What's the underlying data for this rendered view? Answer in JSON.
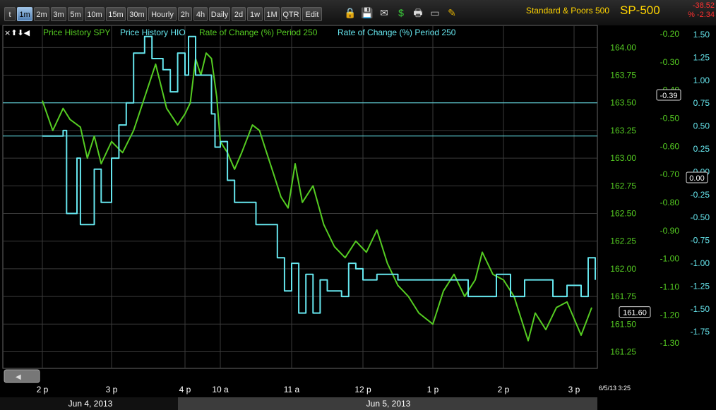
{
  "toolbar": {
    "buttons": [
      "t",
      "1m",
      "2m",
      "3m",
      "5m",
      "10m",
      "15m",
      "30m",
      "Hourly",
      "2h",
      "4h",
      "Daily",
      "2d",
      "1w",
      "1M",
      "QTR",
      "Edit"
    ],
    "active": "1m",
    "icons": [
      "lock-icon",
      "save-icon",
      "mail-icon",
      "dollar-icon",
      "print-icon",
      "window-icon",
      "pencil-icon"
    ]
  },
  "header": {
    "name": "Standard & Poors 500",
    "symbol": "SP-500",
    "change": "-38.52",
    "change_pct": "% -2.34",
    "change_color": "#ff3030",
    "symbol_color": "#ffd400"
  },
  "legend": {
    "controls": "×⬆⬇◀",
    "items": [
      {
        "label": "Price History SPY",
        "color": "#55cc22"
      },
      {
        "label": "Price History HIO",
        "color": "#66e6ee"
      },
      {
        "label": "Rate of Change (%) Period 250",
        "color": "#55cc22"
      },
      {
        "label": "Rate of Change (%) Period 250",
        "color": "#66e6ee"
      }
    ]
  },
  "chart_data": {
    "type": "line",
    "x_ticks": [
      "2 p",
      "3 p",
      "4 p",
      "10 a",
      "11 a",
      "12 p",
      "1 p",
      "2 p",
      "3 p"
    ],
    "date_bar": [
      "Jun 4, 2013",
      "Jun 5, 2013"
    ],
    "corner_label": "6/5/13 3:25",
    "ylim_price": [
      161.1,
      164.2
    ],
    "ylim_roc_spy": [
      -1.39,
      -0.17
    ],
    "ylim_roc_hio": [
      -2.15,
      1.6
    ],
    "y_price_ticks": [
      "164.00",
      "163.75",
      "163.50",
      "163.25",
      "163.00",
      "162.75",
      "162.50",
      "162.25",
      "162.00",
      "161.75",
      "161.50",
      "161.25"
    ],
    "y_roc_spy_ticks": [
      "-0.20",
      "-0.30",
      "-0.40",
      "-0.50",
      "-0.60",
      "-0.70",
      "-0.80",
      "-0.90",
      "-1.00",
      "-1.10",
      "-1.20",
      "-1.30"
    ],
    "y_roc_hio_ticks": [
      "1.50",
      "1.25",
      "1.00",
      "0.75",
      "0.50",
      "0.25",
      "0.00",
      "-0.25",
      "-0.50",
      "-0.75",
      "-1.00",
      "-1.25",
      "-1.50",
      "-1.75"
    ],
    "tags": {
      "price_last": "161.60",
      "spy_roc": "-0.39",
      "hio_roc": "0.00"
    },
    "hlines_price": [
      163.5,
      163.2
    ],
    "grid": true,
    "series": [
      {
        "name": "Price History SPY",
        "color": "#55cc22",
        "points": [
          [
            0,
            163.52
          ],
          [
            0.15,
            163.25
          ],
          [
            0.3,
            163.45
          ],
          [
            0.4,
            163.35
          ],
          [
            0.55,
            163.28
          ],
          [
            0.65,
            163.0
          ],
          [
            0.75,
            163.2
          ],
          [
            0.85,
            162.95
          ],
          [
            1.0,
            163.15
          ],
          [
            1.15,
            163.05
          ],
          [
            1.3,
            163.25
          ],
          [
            1.45,
            163.55
          ],
          [
            1.6,
            163.85
          ],
          [
            1.75,
            163.45
          ],
          [
            1.9,
            163.3
          ],
          [
            2.0,
            163.4
          ],
          [
            2.15,
            163.5
          ],
          [
            2.3,
            163.9
          ],
          [
            2.45,
            163.75
          ],
          [
            2.6,
            163.95
          ],
          [
            2.75,
            163.9
          ],
          [
            2.9,
            163.55
          ],
          [
            3.0,
            163.15
          ],
          [
            3.1,
            163.05
          ],
          [
            3.2,
            162.9
          ],
          [
            3.3,
            163.05
          ],
          [
            3.45,
            163.3
          ],
          [
            3.55,
            163.25
          ],
          [
            3.65,
            163.05
          ],
          [
            3.75,
            162.85
          ],
          [
            3.85,
            162.65
          ],
          [
            3.95,
            162.55
          ],
          [
            4.05,
            162.95
          ],
          [
            4.15,
            162.6
          ],
          [
            4.3,
            162.75
          ],
          [
            4.45,
            162.4
          ],
          [
            4.6,
            162.2
          ],
          [
            4.75,
            162.1
          ],
          [
            4.9,
            162.25
          ],
          [
            5.05,
            162.15
          ],
          [
            5.2,
            162.35
          ],
          [
            5.35,
            162.05
          ],
          [
            5.5,
            161.85
          ],
          [
            5.65,
            161.75
          ],
          [
            5.8,
            161.6
          ],
          [
            6.0,
            161.5
          ],
          [
            6.15,
            161.8
          ],
          [
            6.3,
            161.95
          ],
          [
            6.45,
            161.75
          ],
          [
            6.6,
            161.9
          ],
          [
            6.7,
            162.15
          ],
          [
            6.85,
            161.95
          ],
          [
            7.0,
            161.9
          ],
          [
            7.15,
            161.75
          ],
          [
            7.25,
            161.55
          ],
          [
            7.35,
            161.35
          ],
          [
            7.45,
            161.6
          ],
          [
            7.6,
            161.45
          ],
          [
            7.75,
            161.65
          ],
          [
            7.9,
            161.7
          ],
          [
            8.0,
            161.55
          ],
          [
            8.1,
            161.4
          ],
          [
            8.25,
            161.65
          ]
        ]
      },
      {
        "name": "Price History HIO",
        "color": "#66e6ee",
        "points": [
          [
            0,
            163.2
          ],
          [
            0.15,
            163.2
          ],
          [
            0.3,
            163.25
          ],
          [
            0.35,
            162.5
          ],
          [
            0.5,
            163.0
          ],
          [
            0.55,
            162.4
          ],
          [
            0.65,
            162.4
          ],
          [
            0.75,
            162.9
          ],
          [
            0.85,
            162.6
          ],
          [
            1.0,
            163.0
          ],
          [
            1.1,
            163.3
          ],
          [
            1.2,
            163.5
          ],
          [
            1.3,
            163.95
          ],
          [
            1.45,
            164.1
          ],
          [
            1.55,
            163.9
          ],
          [
            1.7,
            163.8
          ],
          [
            1.8,
            163.6
          ],
          [
            1.9,
            163.95
          ],
          [
            2.0,
            163.75
          ],
          [
            2.1,
            164.1
          ],
          [
            2.3,
            163.75
          ],
          [
            2.5,
            163.75
          ],
          [
            2.65,
            163.75
          ],
          [
            2.75,
            163.4
          ],
          [
            2.85,
            163.1
          ],
          [
            3.0,
            163.15
          ],
          [
            3.1,
            162.8
          ],
          [
            3.2,
            162.6
          ],
          [
            3.35,
            162.6
          ],
          [
            3.5,
            162.4
          ],
          [
            3.7,
            162.4
          ],
          [
            3.8,
            162.1
          ],
          [
            3.9,
            161.8
          ],
          [
            4.0,
            162.05
          ],
          [
            4.1,
            161.6
          ],
          [
            4.2,
            161.95
          ],
          [
            4.3,
            161.6
          ],
          [
            4.4,
            161.9
          ],
          [
            4.5,
            161.8
          ],
          [
            4.6,
            161.8
          ],
          [
            4.7,
            161.75
          ],
          [
            4.8,
            162.05
          ],
          [
            4.9,
            162.0
          ],
          [
            5.0,
            161.9
          ],
          [
            5.2,
            161.95
          ],
          [
            5.4,
            161.95
          ],
          [
            5.5,
            161.9
          ],
          [
            5.7,
            161.9
          ],
          [
            5.9,
            161.9
          ],
          [
            6.1,
            161.9
          ],
          [
            6.3,
            161.9
          ],
          [
            6.5,
            161.75
          ],
          [
            6.7,
            161.75
          ],
          [
            6.9,
            161.95
          ],
          [
            7.1,
            161.75
          ],
          [
            7.3,
            161.9
          ],
          [
            7.5,
            161.9
          ],
          [
            7.7,
            161.75
          ],
          [
            7.9,
            161.85
          ],
          [
            8.1,
            161.75
          ],
          [
            8.2,
            162.1
          ],
          [
            8.3,
            161.9
          ]
        ]
      }
    ]
  }
}
